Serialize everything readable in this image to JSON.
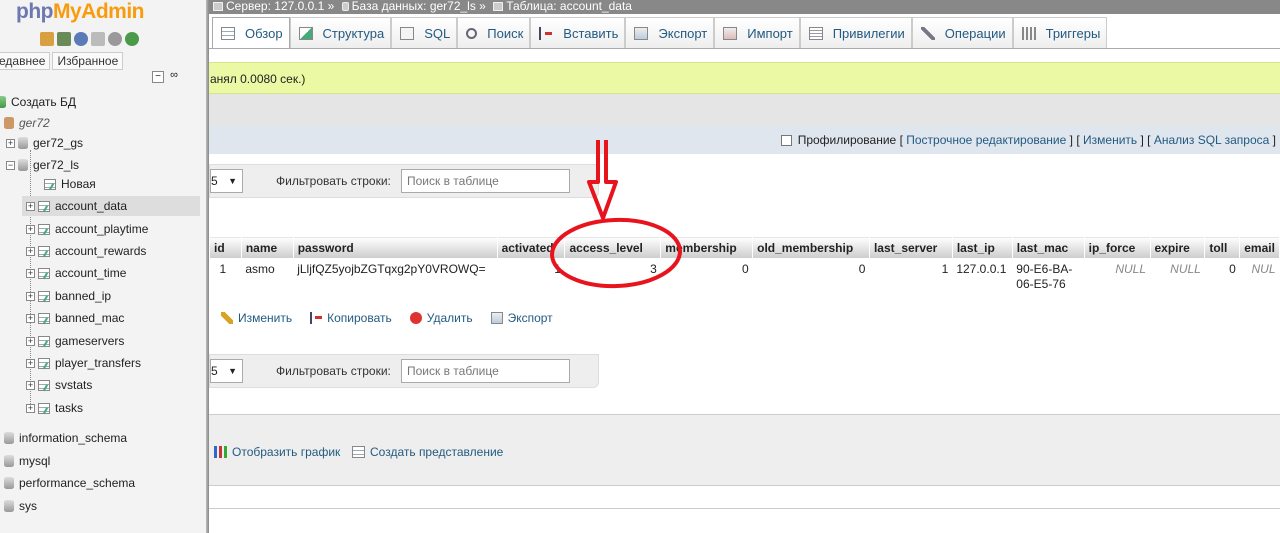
{
  "sidebar": {
    "logo_php": "php",
    "logo_myadmin": "MyAdmin",
    "tabs": [
      "едавнее",
      "Избранное"
    ],
    "tree": [
      {
        "label": "Создать БД"
      },
      {
        "label": "ger72"
      },
      {
        "label": "ger72_gs"
      },
      {
        "label": "ger72_ls"
      },
      {
        "label": "Новая"
      },
      {
        "label": "account_data"
      },
      {
        "label": "account_playtime"
      },
      {
        "label": "account_rewards"
      },
      {
        "label": "account_time"
      },
      {
        "label": "banned_ip"
      },
      {
        "label": "banned_mac"
      },
      {
        "label": "gameservers"
      },
      {
        "label": "player_transfers"
      },
      {
        "label": "svstats"
      },
      {
        "label": "tasks"
      },
      {
        "label": "information_schema"
      },
      {
        "label": "mysql"
      },
      {
        "label": "performance_schema"
      },
      {
        "label": "sys"
      }
    ]
  },
  "breadcrumb": {
    "server": "Сервер: 127.0.0.1 »",
    "database": "База данных: ger72_ls »",
    "table": "Таблица: account_data"
  },
  "menu": [
    "Обзор",
    "Структура",
    "SQL",
    "Поиск",
    "Вставить",
    "Экспорт",
    "Импорт",
    "Привилегии",
    "Операции",
    "Триггеры"
  ],
  "success_msg": "анял 0.0080 сек.)",
  "profiling": {
    "label": "Профилирование",
    "open": "[",
    "inline_edit": "Построчное редактирование",
    "sep1": "] [",
    "edit": "Изменить",
    "sep2": "] [",
    "analyze": "Анализ SQL запроса",
    "close": "]"
  },
  "nav": {
    "rows_value": "5",
    "filter_label": "Фильтровать строки:",
    "filter_placeholder": "Поиск в таблице"
  },
  "table": {
    "headers": [
      "id",
      "name",
      "password",
      "activated",
      "access_level",
      "membership",
      "old_membership",
      "last_server",
      "last_ip",
      "last_mac",
      "ip_force",
      "expire",
      "toll",
      "email"
    ],
    "row": [
      "1",
      "asmo",
      "jLljfQZ5yojbZGTqxg2pY0VROWQ=",
      "1",
      "3",
      "0",
      "0",
      "1",
      "127.0.0.1",
      "90-E6-BA-\n06-E5-76",
      "NULL",
      "NULL",
      "0",
      "NUL"
    ]
  },
  "actions": [
    "Изменить",
    "Копировать",
    "Удалить",
    "Экспорт"
  ],
  "operations": [
    "Отобразить график",
    "Создать представление"
  ],
  "colors": {
    "link": "#235a81",
    "success_bg": "#ebf8a4",
    "annotation": "#e8141d"
  }
}
